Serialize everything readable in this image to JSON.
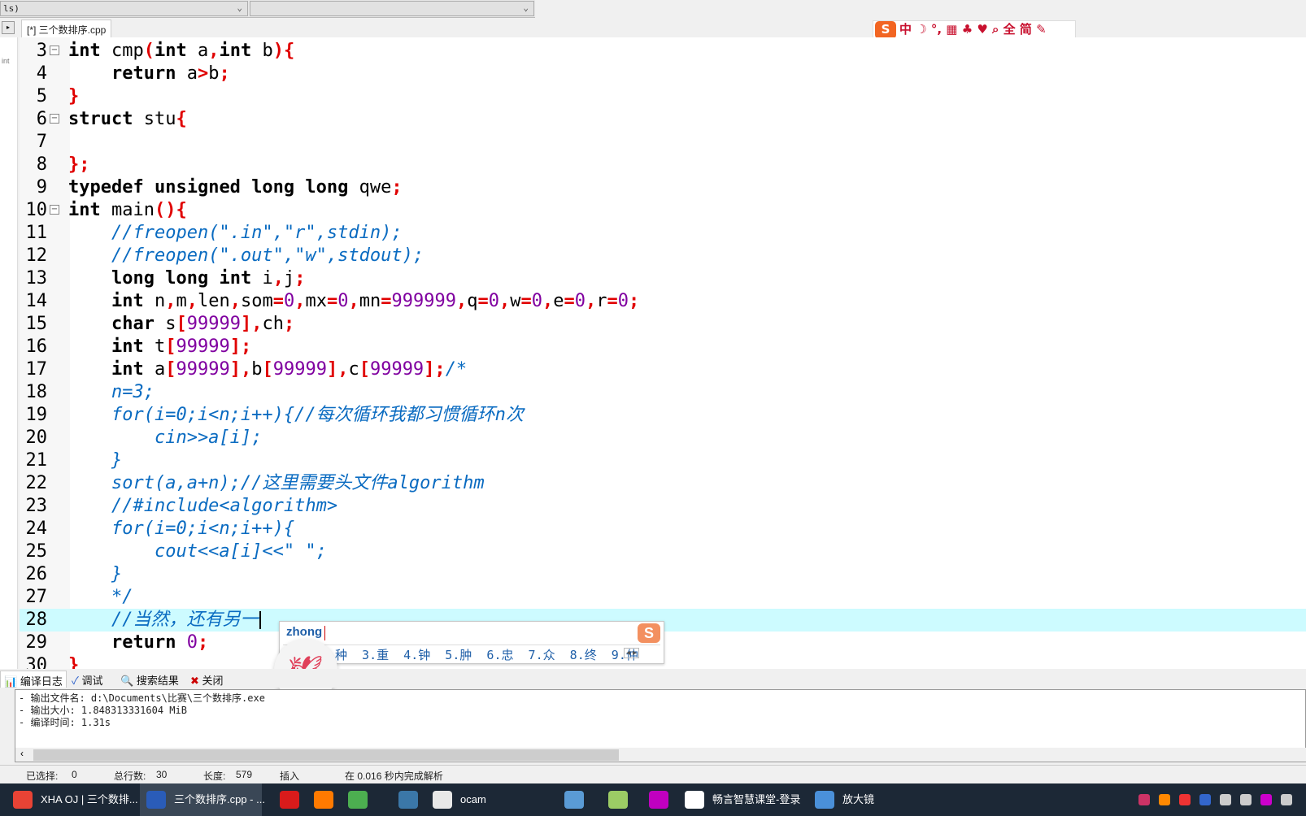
{
  "toolbar": {
    "combo1": "ls)",
    "combo2": ""
  },
  "tab": {
    "label": "[*] 三个数排序.cpp"
  },
  "left_strip": {
    "label": "int"
  },
  "code_lines": [
    {
      "n": "3",
      "fold": "minus",
      "tokens": [
        [
          "int",
          "k"
        ],
        [
          " cmp",
          "t"
        ],
        [
          "(",
          "p"
        ],
        [
          "int",
          "k"
        ],
        [
          " a",
          "t"
        ],
        [
          ",",
          "p"
        ],
        [
          "int",
          "k"
        ],
        [
          " b",
          "t"
        ],
        [
          "){",
          "p"
        ]
      ]
    },
    {
      "n": "4",
      "tokens": [
        [
          "    ",
          "t"
        ],
        [
          "return",
          "k"
        ],
        [
          " a",
          "t"
        ],
        [
          ">",
          "p"
        ],
        [
          "b",
          "t"
        ],
        [
          ";",
          "p"
        ]
      ]
    },
    {
      "n": "5",
      "tokens": [
        [
          "}",
          "p"
        ]
      ]
    },
    {
      "n": "6",
      "fold": "minus",
      "tokens": [
        [
          "struct",
          "k"
        ],
        [
          " stu",
          "t"
        ],
        [
          "{",
          "p"
        ]
      ]
    },
    {
      "n": "7",
      "tokens": []
    },
    {
      "n": "8",
      "tokens": [
        [
          "};",
          "p"
        ]
      ]
    },
    {
      "n": "9",
      "tokens": [
        [
          "typedef",
          "k"
        ],
        [
          " ",
          "t"
        ],
        [
          "unsigned",
          "k"
        ],
        [
          " ",
          "t"
        ],
        [
          "long",
          "k"
        ],
        [
          " ",
          "t"
        ],
        [
          "long",
          "k"
        ],
        [
          " qwe",
          "t"
        ],
        [
          ";",
          "p"
        ]
      ]
    },
    {
      "n": "10",
      "fold": "minus",
      "tokens": [
        [
          "int",
          "k"
        ],
        [
          " main",
          "t"
        ],
        [
          "(){",
          "p"
        ]
      ]
    },
    {
      "n": "11",
      "tokens": [
        [
          "    ",
          "t"
        ],
        [
          "//freopen(\".in\",\"r\",stdin);",
          "c"
        ]
      ]
    },
    {
      "n": "12",
      "tokens": [
        [
          "    ",
          "t"
        ],
        [
          "//freopen(\".out\",\"w\",stdout);",
          "c"
        ]
      ]
    },
    {
      "n": "13",
      "tokens": [
        [
          "    ",
          "t"
        ],
        [
          "long",
          "k"
        ],
        [
          " ",
          "t"
        ],
        [
          "long",
          "k"
        ],
        [
          " ",
          "t"
        ],
        [
          "int",
          "k"
        ],
        [
          " i",
          "t"
        ],
        [
          ",",
          "p"
        ],
        [
          "j",
          "t"
        ],
        [
          ";",
          "p"
        ]
      ]
    },
    {
      "n": "14",
      "tokens": [
        [
          "    ",
          "t"
        ],
        [
          "int",
          "k"
        ],
        [
          " n",
          "t"
        ],
        [
          ",",
          "p"
        ],
        [
          "m",
          "t"
        ],
        [
          ",",
          "p"
        ],
        [
          "len",
          "t"
        ],
        [
          ",",
          "p"
        ],
        [
          "som",
          "t"
        ],
        [
          "=",
          "p"
        ],
        [
          "0",
          "n"
        ],
        [
          ",",
          "p"
        ],
        [
          "mx",
          "t"
        ],
        [
          "=",
          "p"
        ],
        [
          "0",
          "n"
        ],
        [
          ",",
          "p"
        ],
        [
          "mn",
          "t"
        ],
        [
          "=",
          "p"
        ],
        [
          "999999",
          "n"
        ],
        [
          ",",
          "p"
        ],
        [
          "q",
          "t"
        ],
        [
          "=",
          "p"
        ],
        [
          "0",
          "n"
        ],
        [
          ",",
          "p"
        ],
        [
          "w",
          "t"
        ],
        [
          "=",
          "p"
        ],
        [
          "0",
          "n"
        ],
        [
          ",",
          "p"
        ],
        [
          "e",
          "t"
        ],
        [
          "=",
          "p"
        ],
        [
          "0",
          "n"
        ],
        [
          ",",
          "p"
        ],
        [
          "r",
          "t"
        ],
        [
          "=",
          "p"
        ],
        [
          "0",
          "n"
        ],
        [
          ";",
          "p"
        ]
      ]
    },
    {
      "n": "15",
      "tokens": [
        [
          "    ",
          "t"
        ],
        [
          "char",
          "k"
        ],
        [
          " s",
          "t"
        ],
        [
          "[",
          "p"
        ],
        [
          "99999",
          "n"
        ],
        [
          "],",
          "p"
        ],
        [
          "ch",
          "t"
        ],
        [
          ";",
          "p"
        ]
      ]
    },
    {
      "n": "16",
      "tokens": [
        [
          "    ",
          "t"
        ],
        [
          "int",
          "k"
        ],
        [
          " t",
          "t"
        ],
        [
          "[",
          "p"
        ],
        [
          "99999",
          "n"
        ],
        [
          "];",
          "p"
        ]
      ]
    },
    {
      "n": "17",
      "tokens": [
        [
          "    ",
          "t"
        ],
        [
          "int",
          "k"
        ],
        [
          " a",
          "t"
        ],
        [
          "[",
          "p"
        ],
        [
          "99999",
          "n"
        ],
        [
          "],",
          "p"
        ],
        [
          "b",
          "t"
        ],
        [
          "[",
          "p"
        ],
        [
          "99999",
          "n"
        ],
        [
          "],",
          "p"
        ],
        [
          "c",
          "t"
        ],
        [
          "[",
          "p"
        ],
        [
          "99999",
          "n"
        ],
        [
          "];",
          "p"
        ],
        [
          "/*",
          "c"
        ]
      ]
    },
    {
      "n": "18",
      "tokens": [
        [
          "    n=3;",
          "c"
        ]
      ]
    },
    {
      "n": "19",
      "tokens": [
        [
          "    for(i=0;i<n;i++){//每次循环我都习惯循环n次",
          "c"
        ]
      ]
    },
    {
      "n": "20",
      "tokens": [
        [
          "        cin>>a[i];",
          "c"
        ]
      ]
    },
    {
      "n": "21",
      "tokens": [
        [
          "    }",
          "c"
        ]
      ]
    },
    {
      "n": "22",
      "tokens": [
        [
          "    sort(a,a+n);//这里需要头文件algorithm",
          "c"
        ]
      ]
    },
    {
      "n": "23",
      "tokens": [
        [
          "    //#include<algorithm>",
          "c"
        ]
      ]
    },
    {
      "n": "24",
      "tokens": [
        [
          "    for(i=0;i<n;i++){",
          "c"
        ]
      ]
    },
    {
      "n": "25",
      "tokens": [
        [
          "        cout<<a[i]<<\" \";",
          "c"
        ]
      ]
    },
    {
      "n": "26",
      "tokens": [
        [
          "    }",
          "c"
        ]
      ]
    },
    {
      "n": "27",
      "tokens": [
        [
          "    */",
          "c"
        ]
      ]
    },
    {
      "n": "28",
      "highlight": true,
      "tokens": [
        [
          "    //当然，还有另一",
          "c"
        ]
      ]
    },
    {
      "n": "29",
      "tokens": [
        [
          "    ",
          "t"
        ],
        [
          "return",
          "k"
        ],
        [
          " ",
          "t"
        ],
        [
          "0",
          "n"
        ],
        [
          ";",
          "p"
        ]
      ]
    },
    {
      "n": "30",
      "tokens": [
        [
          "}",
          "p"
        ]
      ]
    }
  ],
  "ime": {
    "pinyin": "zhong",
    "candidates": "种  3.重  4.钟  5.肿  6.忠  7.众  8.终  9.仲",
    "logo": "S"
  },
  "ime_toolbar": {
    "logo": "S",
    "items": "中 ☽ °, ▦ ♣ ♥ ⌕ 全 简 ✎"
  },
  "bottom_tabs": [
    {
      "label": "编译日志",
      "icon": "bar-chart-icon"
    },
    {
      "label": "调试",
      "icon": "check-icon"
    },
    {
      "label": "搜索结果",
      "icon": "search-icon"
    },
    {
      "label": "关闭",
      "icon": "close-icon"
    }
  ],
  "log": [
    "- 输出文件名: d:\\Documents\\比赛\\三个数排序.exe",
    "- 输出大小: 1.848313331604 MiB",
    "- 编译时间: 1.31s"
  ],
  "status": {
    "selected_label": "已选择:",
    "selected": "0",
    "lines_label": "总行数:",
    "lines": "30",
    "length_label": "长度:",
    "length": "579",
    "mode": "插入",
    "parse": "在 0.016 秒内完成解析"
  },
  "taskbar": [
    {
      "label": "XHA OJ | 三个数排...",
      "icon": "chrome-icon",
      "color": "#e84335"
    },
    {
      "label": "三个数排序.cpp - ...",
      "icon": "devcpp-icon",
      "color": "#2a5cb8",
      "active": true
    },
    {
      "label": "",
      "icon": "apple-icon",
      "color": "#d81b1b"
    },
    {
      "label": "",
      "icon": "firefox-icon",
      "color": "#ff7a00"
    },
    {
      "label": "",
      "icon": "clover-icon",
      "color": "#4caf50"
    },
    {
      "label": "",
      "icon": "python-icon",
      "color": "#3b77a8"
    },
    {
      "label": "ocam",
      "icon": "ocam-icon",
      "color": "#e8e8e8"
    },
    {
      "label": "",
      "icon": "folder-icon",
      "color": "#5a9bd5"
    },
    {
      "label": "",
      "icon": "paint-icon",
      "color": "#9ccc65"
    },
    {
      "label": "",
      "icon": "scissors-icon",
      "color": "#c000c0"
    },
    {
      "label": "畅言智慧课堂-登录",
      "icon": "changyan-icon",
      "color": "#ffffff"
    },
    {
      "label": "放大镜",
      "icon": "magnifier-icon",
      "color": "#4a90d9"
    }
  ]
}
